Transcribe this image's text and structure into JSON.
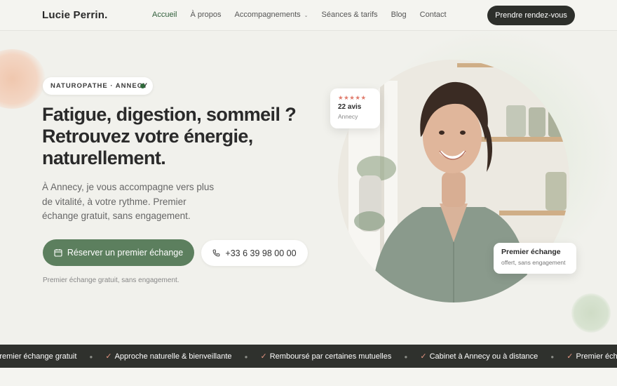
{
  "brand": {
    "logo": "Lucie Perrin."
  },
  "nav": {
    "items": [
      {
        "label": "Accueil",
        "active": true
      },
      {
        "label": "À propos"
      },
      {
        "label": "Accompagnements",
        "dropdown": true
      },
      {
        "label": "Séances & tarifs"
      },
      {
        "label": "Blog"
      },
      {
        "label": "Contact"
      }
    ],
    "cta": "Prendre rendez-vous"
  },
  "hero": {
    "tag": "NATUROPATHE · ANNECY",
    "headline": [
      "Fatigue, digestion, sommeil ?",
      "Retrouvez votre énergie,",
      "naturellement."
    ],
    "intro": "À Annecy, je vous accompagne vers plus de vitalité, à votre rythme. Premier échange gratuit, sans engagement.",
    "primary_button": "Réserver un premier échange",
    "phone_button": "+33 6 39 98 00 00",
    "note": "Premier échange gratuit, sans engagement."
  },
  "review_card": {
    "rating_stars": 5,
    "count": "22 avis",
    "location": "Annecy"
  },
  "offer_card": {
    "title": "Premier échange",
    "subtitle": "offert, sans engagement"
  },
  "marquee": {
    "items": [
      "Premier échange gratuit",
      "Approche naturelle & bienveillante",
      "Remboursé par certaines mutuelles",
      "Cabinet à Annecy ou à distance",
      "Premier échange gratuit"
    ]
  },
  "colors": {
    "accent_green": "#5c7f5e",
    "nav_active": "#2f5e3a",
    "dark": "#2d2f2b",
    "star": "#e07b6c"
  },
  "icons": {
    "primary_button": "calendar-icon",
    "phone_button": "phone-icon"
  }
}
